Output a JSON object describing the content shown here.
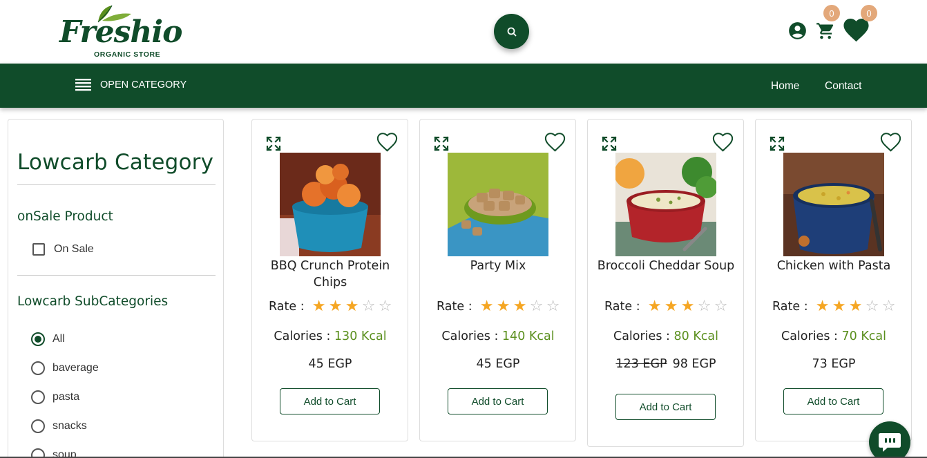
{
  "brand": {
    "name": "Freshio",
    "tagline": "ORGANIC STORE"
  },
  "header": {
    "cart_count": "0",
    "wishlist_count": "0"
  },
  "nav": {
    "open_category": "OPEN CATEGORY",
    "links": [
      "Home",
      "Contact"
    ]
  },
  "sidebar": {
    "title": "Lowcarb Category",
    "onsale_heading": "onSale Product",
    "onsale_label": "On Sale",
    "onsale_checked": false,
    "subcat_heading": "Lowcarb SubCategories",
    "subcategories": [
      {
        "label": "All",
        "selected": true
      },
      {
        "label": "baverage",
        "selected": false
      },
      {
        "label": "pasta",
        "selected": false
      },
      {
        "label": "snacks",
        "selected": false
      },
      {
        "label": "soup",
        "selected": false
      }
    ]
  },
  "product_labels": {
    "rate": "Rate :",
    "calories": "Calories :",
    "add_to_cart": "Add to Cart"
  },
  "products": [
    {
      "name": "BBQ Crunch Protein Chips",
      "rating": 3,
      "max_rating": 5,
      "calories": "130 Kcal",
      "old_price": "",
      "price": "45 EGP",
      "image": "bbq-chips-bowl"
    },
    {
      "name": "Party Mix",
      "rating": 3,
      "max_rating": 5,
      "calories": "140 Kcal",
      "old_price": "",
      "price": "45 EGP",
      "image": "party-mix-bowl"
    },
    {
      "name": "Broccoli Cheddar Soup",
      "rating": 3,
      "max_rating": 5,
      "calories": "80 Kcal",
      "old_price": "123 EGP",
      "price": "98 EGP",
      "image": "broccoli-soup-bowl"
    },
    {
      "name": "Chicken with Pasta",
      "rating": 3,
      "max_rating": 5,
      "calories": "70 Kcal",
      "old_price": "",
      "price": "73 EGP",
      "image": "chicken-pasta-soup-bowl"
    }
  ],
  "colors": {
    "brand_green": "#104c2a",
    "badge": "#e3a87a",
    "star": "#f5a623",
    "calorie_value": "#5a8f1d"
  },
  "icons": [
    "search-icon",
    "account-icon",
    "cart-icon",
    "heart-icon",
    "menu-icon",
    "expand-icon",
    "heart-outline-icon",
    "star-icon",
    "chat-icon"
  ]
}
